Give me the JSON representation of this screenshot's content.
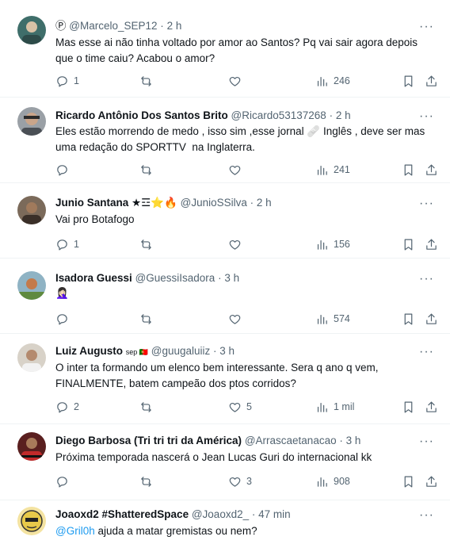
{
  "tweets": [
    {
      "name": "",
      "badge": "Ⓟ",
      "handle": "@Marcelo_SEP12",
      "time": "2 h",
      "text": "Mas esse ai não tinha voltado por amor ao Santos? Pq vai sair agora depois que o time caiu? Acabou o amor?",
      "replies": "1",
      "retweets": "",
      "likes": "",
      "views": "246",
      "avatar_color": "#3f6e6a"
    },
    {
      "name": "Ricardo Antônio Dos Santos Brito",
      "handle": "@Ricardo53137268",
      "time": "2 h",
      "text": "Eles estão morrendo de medo , isso sim ,esse jornal 🩹 Inglês , deve ser mas uma redação do SPORTTV  na Inglaterra.",
      "replies": "",
      "retweets": "",
      "likes": "",
      "views": "241",
      "avatar_color": "#8a8f95"
    },
    {
      "name": "Junio Santana ★☲⭐🔥",
      "handle": "@JunioSSilva",
      "time": "2 h",
      "text": "Vai pro Botafogo",
      "replies": "1",
      "retweets": "",
      "likes": "",
      "views": "156",
      "avatar_color": "#6b5a4a"
    },
    {
      "name": "Isadora Guessi",
      "handle": "@GuessiIsadora",
      "time": "3 h",
      "text": "🤦🏻‍♀️",
      "replies": "",
      "retweets": "",
      "likes": "",
      "views": "574",
      "avatar_color": "#7fa3b5"
    },
    {
      "name": "Luiz Augusto",
      "name_suffix": "sep 🇵🇹",
      "handle": "@guugaluiiz",
      "time": "3 h",
      "text": "O inter ta formando um elenco bem interessante. Sera q ano q vem, FINALMENTE, batem campeão dos ptos corridos?",
      "replies": "2",
      "retweets": "",
      "likes": "5",
      "views": "1 mil",
      "avatar_color": "#c9c3b8"
    },
    {
      "name": "Diego Barbosa (Tri tri tri da América)",
      "handle": "@Arrascaetanacao",
      "time": "3 h",
      "text": "Próxima temporada nascerá o Jean Lucas Guri do internacional kk",
      "replies": "",
      "retweets": "",
      "likes": "3",
      "views": "908",
      "avatar_color": "#8b2a2a"
    },
    {
      "name": "Joaoxd2 #ShatteredSpace",
      "handle": "@Joaoxd2_",
      "time": "47 min",
      "mention": "@Gril0h",
      "text": " ajuda a matar gremistas ou nem?",
      "avatar_color": "#e8c94a"
    }
  ],
  "labels": {
    "dot": "·",
    "more": "···"
  },
  "icons": [
    "reply-icon",
    "retweet-icon",
    "like-icon",
    "views-icon",
    "bookmark-icon",
    "share-icon",
    "more-icon",
    "verified-icon"
  ]
}
